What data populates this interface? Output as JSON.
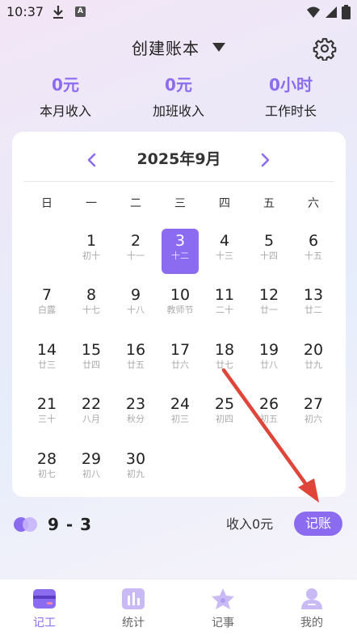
{
  "status_bar": {
    "time": "10:37",
    "a_badge": "A"
  },
  "header": {
    "book_name": "创建账本"
  },
  "stats": [
    {
      "value": "0元",
      "label": "本月收入"
    },
    {
      "value": "0元",
      "label": "加班收入"
    },
    {
      "value": "0小时",
      "label": "工作时长"
    }
  ],
  "calendar": {
    "month_title": "2025年9月",
    "weekdays": [
      "日",
      "一",
      "二",
      "三",
      "四",
      "五",
      "六"
    ],
    "selected_day": "3",
    "days": [
      {
        "num": "1",
        "lunar": "初十"
      },
      {
        "num": "2",
        "lunar": "十一"
      },
      {
        "num": "3",
        "lunar": "十二"
      },
      {
        "num": "4",
        "lunar": "十三"
      },
      {
        "num": "5",
        "lunar": "十四"
      },
      {
        "num": "6",
        "lunar": "十五"
      },
      {
        "num": "7",
        "lunar": "白露"
      },
      {
        "num": "8",
        "lunar": "十七"
      },
      {
        "num": "9",
        "lunar": "十八"
      },
      {
        "num": "10",
        "lunar": "教师节"
      },
      {
        "num": "11",
        "lunar": "二十"
      },
      {
        "num": "12",
        "lunar": "廿一"
      },
      {
        "num": "13",
        "lunar": "廿二"
      },
      {
        "num": "14",
        "lunar": "廿三"
      },
      {
        "num": "15",
        "lunar": "廿四"
      },
      {
        "num": "16",
        "lunar": "廿五"
      },
      {
        "num": "17",
        "lunar": "廿六"
      },
      {
        "num": "18",
        "lunar": "廿七"
      },
      {
        "num": "19",
        "lunar": "廿八"
      },
      {
        "num": "20",
        "lunar": "廿九"
      },
      {
        "num": "21",
        "lunar": "三十"
      },
      {
        "num": "22",
        "lunar": "八月"
      },
      {
        "num": "23",
        "lunar": "秋分"
      },
      {
        "num": "24",
        "lunar": "初三"
      },
      {
        "num": "25",
        "lunar": "初四"
      },
      {
        "num": "26",
        "lunar": "初五"
      },
      {
        "num": "27",
        "lunar": "初六"
      },
      {
        "num": "28",
        "lunar": "初七"
      },
      {
        "num": "29",
        "lunar": "初八"
      },
      {
        "num": "30",
        "lunar": "初九"
      }
    ]
  },
  "footer": {
    "selected_date": "9 - 3",
    "income": "收入0元",
    "record_button": "记账"
  },
  "bottom_nav": [
    {
      "label": "记工",
      "icon": "card-icon"
    },
    {
      "label": "统计",
      "icon": "bar-chart-icon"
    },
    {
      "label": "记事",
      "icon": "star-icon"
    },
    {
      "label": "我的",
      "icon": "person-icon"
    }
  ],
  "colors": {
    "accent": "#8b6cf0",
    "arrow": "#e0453a"
  }
}
